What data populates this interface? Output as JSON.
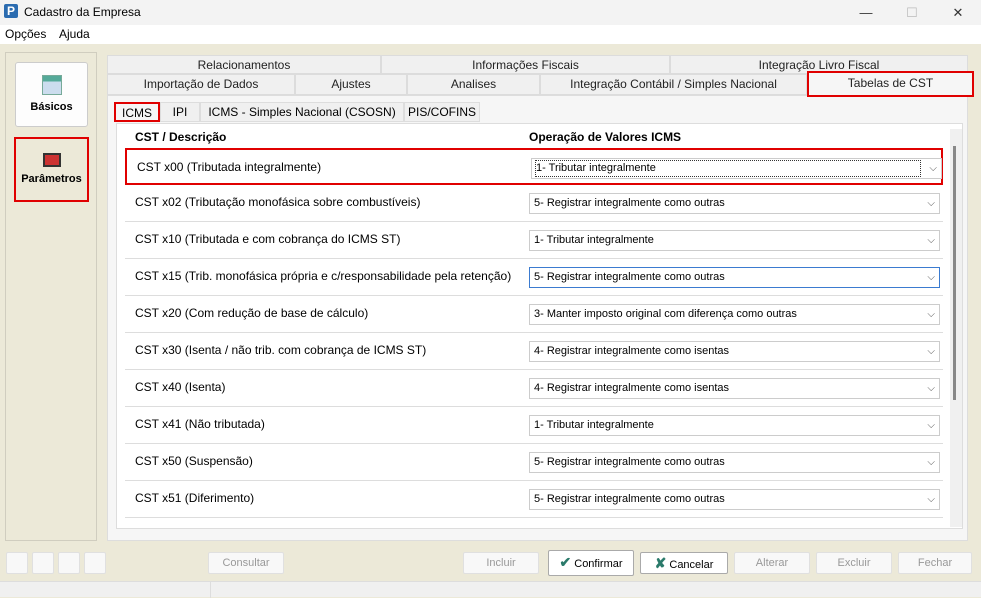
{
  "window": {
    "title": "Cadastro da Empresa",
    "minimize": "—",
    "maximize": "☐",
    "close": "✕"
  },
  "menu": [
    "Opções",
    "Ajuda"
  ],
  "sidebar": {
    "items": [
      {
        "label": "Básicos",
        "icon": "spreadsheet-icon"
      },
      {
        "label": "Parâmetros",
        "icon": "parameters-icon"
      }
    ]
  },
  "tabs_row1": [
    "Relacionamentos",
    "Informações Fiscais",
    "Integração Livro Fiscal"
  ],
  "tabs_row2": [
    "Importação de Dados",
    "Ajustes",
    "Analises",
    "Integração Contábil / Simples Nacional",
    "Tabelas de CST"
  ],
  "subtabs": [
    "ICMS",
    "IPI",
    "ICMS - Simples Nacional (CSOSN)",
    "PIS/COFINS"
  ],
  "grid": {
    "headers": [
      "CST / Descrição",
      "Operação de Valores ICMS"
    ],
    "rows": [
      {
        "cst": "CST x00 (Tributada integralmente)",
        "op": "1- Tributar integralmente"
      },
      {
        "cst": "CST x02 (Tributação monofásica sobre combustíveis)",
        "op": "5- Registrar integralmente como outras"
      },
      {
        "cst": "CST x10 (Tributada e com cobrança do ICMS ST)",
        "op": "1- Tributar integralmente"
      },
      {
        "cst": "CST x15 (Trib. monofásica própria e c/responsabilidade pela retenção)",
        "op": "5- Registrar integralmente como outras"
      },
      {
        "cst": "CST x20 (Com redução de base de cálculo)",
        "op": "3- Manter imposto original com diferença como outras"
      },
      {
        "cst": "CST x30 (Isenta / não trib. com cobrança de ICMS ST)",
        "op": "4- Registrar integralmente como isentas"
      },
      {
        "cst": "CST x40 (Isenta)",
        "op": "4- Registrar integralmente como isentas"
      },
      {
        "cst": "CST x41 (Não tributada)",
        "op": "1- Tributar integralmente"
      },
      {
        "cst": "CST x50 (Suspensão)",
        "op": "5- Registrar integralmente como outras"
      },
      {
        "cst": "CST x51 (Diferimento)",
        "op": "5- Registrar integralmente como outras"
      }
    ]
  },
  "buttons": {
    "consultar": "Consultar",
    "incluir": "Incluir",
    "confirmar": "Confirmar",
    "cancelar": "Cancelar",
    "alterar": "Alterar",
    "excluir": "Excluir",
    "fechar": "Fechar"
  },
  "colors": {
    "highlight": "#e00000",
    "accent": "#2b6cb0"
  }
}
